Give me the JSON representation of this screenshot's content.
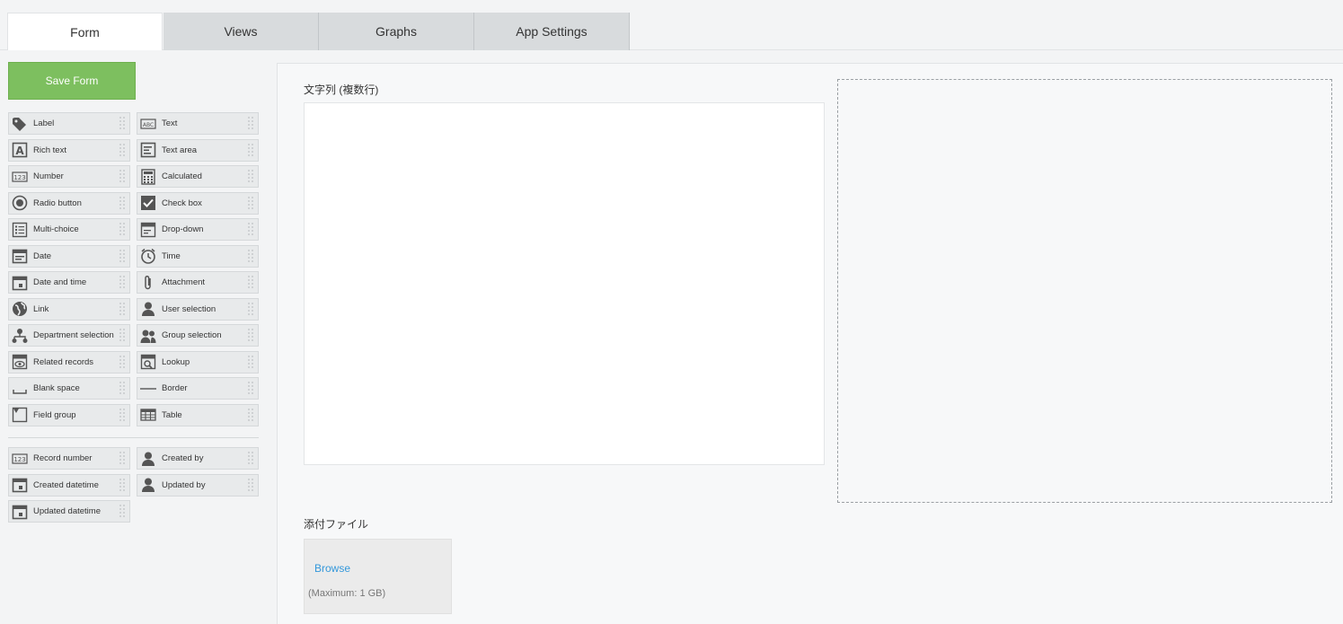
{
  "tabs": [
    {
      "label": "Form",
      "active": true
    },
    {
      "label": "Views",
      "active": false
    },
    {
      "label": "Graphs",
      "active": false
    },
    {
      "label": "App Settings",
      "active": false
    }
  ],
  "palette": {
    "save_label": "Save Form",
    "items": [
      {
        "label": "Label",
        "icon": "tag-icon"
      },
      {
        "label": "Text",
        "icon": "abc-icon"
      },
      {
        "label": "Rich text",
        "icon": "rich-text-icon"
      },
      {
        "label": "Text area",
        "icon": "text-area-icon"
      },
      {
        "label": "Number",
        "icon": "number-123-icon"
      },
      {
        "label": "Calculated",
        "icon": "calculator-icon"
      },
      {
        "label": "Radio button",
        "icon": "radio-icon"
      },
      {
        "label": "Check box",
        "icon": "checkbox-icon"
      },
      {
        "label": "Multi-choice",
        "icon": "multi-choice-icon"
      },
      {
        "label": "Drop-down",
        "icon": "dropdown-icon"
      },
      {
        "label": "Date",
        "icon": "date-icon"
      },
      {
        "label": "Time",
        "icon": "clock-icon"
      },
      {
        "label": "Date and time",
        "icon": "calendar-icon"
      },
      {
        "label": "Attachment",
        "icon": "paperclip-icon"
      },
      {
        "label": "Link",
        "icon": "globe-icon"
      },
      {
        "label": "User selection",
        "icon": "user-icon"
      },
      {
        "label": "Department selection",
        "icon": "org-chart-icon"
      },
      {
        "label": "Group selection",
        "icon": "group-icon"
      },
      {
        "label": "Related records",
        "icon": "related-records-icon"
      },
      {
        "label": "Lookup",
        "icon": "lookup-icon"
      },
      {
        "label": "Blank space",
        "icon": "blank-space-icon"
      },
      {
        "label": "Border",
        "icon": "border-line-icon"
      },
      {
        "label": "Field group",
        "icon": "field-group-icon"
      },
      {
        "label": "Table",
        "icon": "table-icon"
      }
    ],
    "system_items": [
      {
        "label": "Record number",
        "icon": "number-123-icon"
      },
      {
        "label": "Created by",
        "icon": "user-icon"
      },
      {
        "label": "Created datetime",
        "icon": "calendar-icon"
      },
      {
        "label": "Updated by",
        "icon": "user-icon"
      },
      {
        "label": "Updated datetime",
        "icon": "calendar-icon"
      }
    ]
  },
  "canvas": {
    "multiline_label": "文字列 (複数行)",
    "attachment_label": "添付ファイル",
    "browse_label": "Browse",
    "max_note": "(Maximum: 1 GB)"
  },
  "colors": {
    "save": "#7dbf5f",
    "link": "#3498db",
    "icon": "#555555"
  }
}
